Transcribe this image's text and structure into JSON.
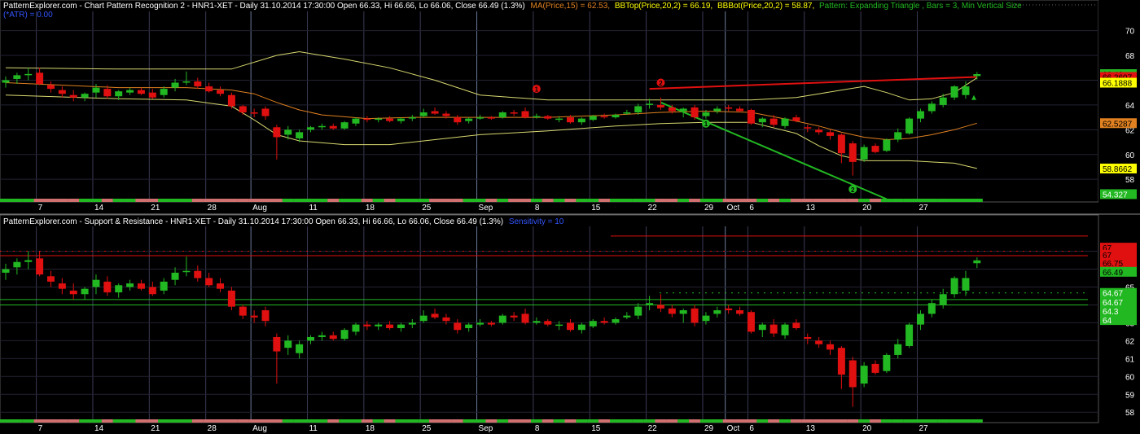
{
  "chart_data": [
    {
      "type": "candlestick",
      "panel": "top",
      "header": {
        "main": "PatternExplorer.com - Chart Pattern Recognition 2 - HNR1-XET - Daily 31.10.2014 17:30:00 Open 66.33, Hi 66.66, Lo 66.06, Close 66.49 (1.3%)",
        "ma": "MA(Price,15) = 62.53,",
        "bbtop": "BBTop(Price,20,2) = 66.19,",
        "bbbot": "BBBot(Price,20,2) = 58.87,",
        "pattern": "Pattern: Expanding Triangle , Bars = 3, Min Vertical Size",
        "atr": "(*ATR) = 0.00"
      },
      "y_ticks": [
        "70",
        "68",
        "66",
        "64",
        "62",
        "60",
        "58"
      ],
      "ylim": [
        56.5,
        70.5
      ],
      "price_tags": [
        {
          "text": "66.49",
          "value": 66.49,
          "bg": "#22b822",
          "fg": "#000000"
        },
        {
          "text": "66.2607",
          "value": 66.26,
          "bg": "#e01010",
          "fg": "#000000"
        },
        {
          "text": "66.1888",
          "value": 65.8,
          "bg": "#ffff00",
          "fg": "#000000"
        },
        {
          "text": "62.5287",
          "value": 62.53,
          "bg": "#e08020",
          "fg": "#000000"
        },
        {
          "text": "58.8662",
          "value": 58.87,
          "bg": "#ffff00",
          "fg": "#000000"
        },
        {
          "text": "54.327",
          "value": 56.8,
          "bg": "#22b822",
          "fg": "#ffffff"
        }
      ],
      "markers": [
        {
          "label": "1",
          "bar": 47,
          "value": 65.3,
          "color": "#e01010"
        },
        {
          "label": "2",
          "bar": 58,
          "value": 65.8,
          "color": "#e01010"
        },
        {
          "label": "1",
          "bar": 62,
          "value": 62.5,
          "color": "#22b822"
        },
        {
          "label": "2",
          "bar": 75,
          "value": 57.2,
          "color": "#22b822"
        }
      ]
    },
    {
      "type": "candlestick",
      "panel": "bottom",
      "header": {
        "main": "PatternExplorer.com - Support & Resistance - HNR1-XET - Daily 31.10.2014 17:30:00 Open 66.33, Hi 66.66, Lo 66.06, Close 66.49 (1.3%)",
        "sens": "Sensitivity = 10"
      },
      "y_ticks": [
        "67",
        "66",
        "65",
        "64",
        "63",
        "62",
        "61",
        "60",
        "59",
        "58"
      ],
      "ylim": [
        57.6,
        68.3
      ],
      "price_tags": [
        {
          "text": "67",
          "value": 67.2,
          "bg": "#e01010",
          "fg": "#000000"
        },
        {
          "text": "67",
          "value": 66.8,
          "bg": "#e01010",
          "fg": "#000000"
        },
        {
          "text": "66.75",
          "value": 66.35,
          "bg": "#e01010",
          "fg": "#000000"
        },
        {
          "text": "66.49",
          "value": 65.85,
          "bg": "#22b822",
          "fg": "#000000"
        },
        {
          "text": "64.67",
          "value": 64.67,
          "bg": "#22b822",
          "fg": "#ffffff"
        },
        {
          "text": "64.67",
          "value": 64.15,
          "bg": "#22b822",
          "fg": "#ffffff"
        },
        {
          "text": "64.3",
          "value": 63.65,
          "bg": "#22b822",
          "fg": "#ffffff"
        },
        {
          "text": "64",
          "value": 63.15,
          "bg": "#22b822",
          "fg": "#ffffff"
        }
      ],
      "levels": [
        {
          "value": 67.85,
          "color": "#e01010"
        },
        {
          "value": 67.0,
          "color": "#e01010"
        },
        {
          "value": 66.75,
          "color": "#e01010"
        },
        {
          "value": 64.67,
          "color": "#22b822"
        },
        {
          "value": 64.3,
          "color": "#22b822"
        },
        {
          "value": 64.0,
          "color": "#22b822"
        }
      ]
    }
  ],
  "x_ticks": [
    {
      "label": "7",
      "bar": 3,
      "month": false
    },
    {
      "label": "14",
      "bar": 8,
      "month": false
    },
    {
      "label": "21",
      "bar": 13,
      "month": false
    },
    {
      "label": "28",
      "bar": 18,
      "month": false
    },
    {
      "label": "Aug",
      "bar": 22,
      "month": true
    },
    {
      "label": "11",
      "bar": 27,
      "month": false
    },
    {
      "label": "18",
      "bar": 32,
      "month": false
    },
    {
      "label": "25",
      "bar": 37,
      "month": false
    },
    {
      "label": "Sep",
      "bar": 42,
      "month": true
    },
    {
      "label": "8",
      "bar": 47,
      "month": false
    },
    {
      "label": "15",
      "bar": 52,
      "month": false
    },
    {
      "label": "22",
      "bar": 57,
      "month": false
    },
    {
      "label": "29",
      "bar": 62,
      "month": false
    },
    {
      "label": "Oct",
      "bar": 64,
      "month": true
    },
    {
      "label": "6",
      "bar": 66,
      "month": false
    },
    {
      "label": "13",
      "bar": 71,
      "month": false
    },
    {
      "label": "20",
      "bar": 76,
      "month": false
    },
    {
      "label": "27",
      "bar": 81,
      "month": false
    }
  ],
  "candles": [
    {
      "o": 65.8,
      "h": 66.3,
      "l": 65.4,
      "c": 66.0
    },
    {
      "o": 66.1,
      "h": 66.6,
      "l": 65.7,
      "c": 66.4
    },
    {
      "o": 66.4,
      "h": 67.0,
      "l": 66.0,
      "c": 66.5
    },
    {
      "o": 66.6,
      "h": 67.0,
      "l": 65.6,
      "c": 65.7
    },
    {
      "o": 65.6,
      "h": 65.9,
      "l": 65.0,
      "c": 65.3
    },
    {
      "o": 65.2,
      "h": 65.5,
      "l": 64.6,
      "c": 64.9
    },
    {
      "o": 64.8,
      "h": 65.2,
      "l": 64.3,
      "c": 64.6
    },
    {
      "o": 64.6,
      "h": 65.0,
      "l": 64.3,
      "c": 64.9
    },
    {
      "o": 65.0,
      "h": 65.7,
      "l": 64.6,
      "c": 65.4
    },
    {
      "o": 65.3,
      "h": 65.6,
      "l": 64.5,
      "c": 64.7
    },
    {
      "o": 64.7,
      "h": 65.2,
      "l": 64.4,
      "c": 65.1
    },
    {
      "o": 65.0,
      "h": 65.4,
      "l": 64.8,
      "c": 65.2
    },
    {
      "o": 65.2,
      "h": 65.4,
      "l": 64.8,
      "c": 64.9
    },
    {
      "o": 65.0,
      "h": 65.3,
      "l": 64.5,
      "c": 64.6
    },
    {
      "o": 64.8,
      "h": 65.5,
      "l": 64.6,
      "c": 65.3
    },
    {
      "o": 65.4,
      "h": 66.1,
      "l": 65.1,
      "c": 65.8
    },
    {
      "o": 65.9,
      "h": 66.7,
      "l": 65.6,
      "c": 65.9
    },
    {
      "o": 65.9,
      "h": 66.2,
      "l": 65.3,
      "c": 65.5
    },
    {
      "o": 65.5,
      "h": 65.8,
      "l": 65.0,
      "c": 65.1
    },
    {
      "o": 65.2,
      "h": 65.5,
      "l": 64.7,
      "c": 64.9
    },
    {
      "o": 64.8,
      "h": 65.0,
      "l": 63.7,
      "c": 63.9
    },
    {
      "o": 63.9,
      "h": 64.0,
      "l": 63.2,
      "c": 63.4
    },
    {
      "o": 63.4,
      "h": 63.7,
      "l": 63.0,
      "c": 63.3
    },
    {
      "o": 63.7,
      "h": 63.9,
      "l": 62.8,
      "c": 63.1
    },
    {
      "o": 62.2,
      "h": 62.4,
      "l": 59.6,
      "c": 61.4
    },
    {
      "o": 61.6,
      "h": 62.3,
      "l": 61.2,
      "c": 62.0
    },
    {
      "o": 61.3,
      "h": 62.0,
      "l": 61.0,
      "c": 61.8
    },
    {
      "o": 62.0,
      "h": 62.3,
      "l": 61.8,
      "c": 62.2
    },
    {
      "o": 62.2,
      "h": 62.5,
      "l": 62.0,
      "c": 62.3
    },
    {
      "o": 62.3,
      "h": 62.5,
      "l": 62.0,
      "c": 62.1
    },
    {
      "o": 62.1,
      "h": 62.7,
      "l": 62.0,
      "c": 62.6
    },
    {
      "o": 62.5,
      "h": 63.0,
      "l": 62.3,
      "c": 62.9
    },
    {
      "o": 62.9,
      "h": 63.1,
      "l": 62.6,
      "c": 62.8
    },
    {
      "o": 62.8,
      "h": 63.0,
      "l": 62.6,
      "c": 62.9
    },
    {
      "o": 62.9,
      "h": 63.1,
      "l": 62.6,
      "c": 62.7
    },
    {
      "o": 62.7,
      "h": 63.0,
      "l": 62.5,
      "c": 62.9
    },
    {
      "o": 62.9,
      "h": 63.2,
      "l": 62.7,
      "c": 63.0
    },
    {
      "o": 63.1,
      "h": 63.7,
      "l": 63.0,
      "c": 63.4
    },
    {
      "o": 63.5,
      "h": 63.8,
      "l": 63.2,
      "c": 63.3
    },
    {
      "o": 63.3,
      "h": 63.5,
      "l": 62.9,
      "c": 63.1
    },
    {
      "o": 63.0,
      "h": 63.2,
      "l": 62.4,
      "c": 62.6
    },
    {
      "o": 62.7,
      "h": 63.0,
      "l": 62.5,
      "c": 62.9
    },
    {
      "o": 62.9,
      "h": 63.2,
      "l": 62.8,
      "c": 63.0
    },
    {
      "o": 63.0,
      "h": 63.1,
      "l": 62.8,
      "c": 62.9
    },
    {
      "o": 63.0,
      "h": 63.5,
      "l": 62.9,
      "c": 63.4
    },
    {
      "o": 63.4,
      "h": 63.6,
      "l": 63.1,
      "c": 63.3
    },
    {
      "o": 63.5,
      "h": 63.8,
      "l": 62.9,
      "c": 63.0
    },
    {
      "o": 63.0,
      "h": 63.3,
      "l": 62.9,
      "c": 63.1
    },
    {
      "o": 63.1,
      "h": 63.2,
      "l": 62.8,
      "c": 62.9
    },
    {
      "o": 62.9,
      "h": 63.1,
      "l": 62.6,
      "c": 62.9
    },
    {
      "o": 63.0,
      "h": 63.2,
      "l": 62.5,
      "c": 62.6
    },
    {
      "o": 62.6,
      "h": 63.0,
      "l": 62.4,
      "c": 62.9
    },
    {
      "o": 62.8,
      "h": 63.2,
      "l": 62.7,
      "c": 63.1
    },
    {
      "o": 63.1,
      "h": 63.3,
      "l": 62.9,
      "c": 63.0
    },
    {
      "o": 63.0,
      "h": 63.3,
      "l": 62.9,
      "c": 63.2
    },
    {
      "o": 63.3,
      "h": 63.6,
      "l": 63.2,
      "c": 63.4
    },
    {
      "o": 63.4,
      "h": 64.1,
      "l": 63.2,
      "c": 63.9
    },
    {
      "o": 64.0,
      "h": 64.5,
      "l": 63.7,
      "c": 64.1
    },
    {
      "o": 64.0,
      "h": 64.6,
      "l": 63.6,
      "c": 63.8
    },
    {
      "o": 63.8,
      "h": 64.0,
      "l": 63.3,
      "c": 63.5
    },
    {
      "o": 63.5,
      "h": 63.8,
      "l": 63.0,
      "c": 63.7
    },
    {
      "o": 63.8,
      "h": 64.0,
      "l": 62.8,
      "c": 63.0
    },
    {
      "o": 63.1,
      "h": 63.6,
      "l": 62.9,
      "c": 63.4
    },
    {
      "o": 63.5,
      "h": 63.9,
      "l": 63.3,
      "c": 63.7
    },
    {
      "o": 63.8,
      "h": 64.0,
      "l": 63.5,
      "c": 63.7
    },
    {
      "o": 63.7,
      "h": 63.9,
      "l": 63.4,
      "c": 63.5
    },
    {
      "o": 63.6,
      "h": 63.7,
      "l": 62.4,
      "c": 62.5
    },
    {
      "o": 62.6,
      "h": 63.0,
      "l": 62.2,
      "c": 62.9
    },
    {
      "o": 62.9,
      "h": 63.2,
      "l": 62.2,
      "c": 62.4
    },
    {
      "o": 62.3,
      "h": 63.0,
      "l": 62.1,
      "c": 62.9
    },
    {
      "o": 63.0,
      "h": 63.2,
      "l": 62.6,
      "c": 62.7
    },
    {
      "o": 62.2,
      "h": 62.4,
      "l": 61.8,
      "c": 62.1
    },
    {
      "o": 62.0,
      "h": 62.2,
      "l": 61.6,
      "c": 61.8
    },
    {
      "o": 61.8,
      "h": 62.0,
      "l": 61.2,
      "c": 61.5
    },
    {
      "o": 61.6,
      "h": 61.7,
      "l": 59.3,
      "c": 60.1
    },
    {
      "o": 60.9,
      "h": 61.1,
      "l": 58.3,
      "c": 59.4
    },
    {
      "o": 59.6,
      "h": 60.8,
      "l": 59.4,
      "c": 60.6
    },
    {
      "o": 60.7,
      "h": 60.9,
      "l": 60.1,
      "c": 60.2
    },
    {
      "o": 60.3,
      "h": 61.3,
      "l": 60.2,
      "c": 61.2
    },
    {
      "o": 61.2,
      "h": 62.1,
      "l": 61.0,
      "c": 61.8
    },
    {
      "o": 61.7,
      "h": 63.0,
      "l": 61.6,
      "c": 62.9
    },
    {
      "o": 62.9,
      "h": 63.7,
      "l": 62.6,
      "c": 63.5
    },
    {
      "o": 63.5,
      "h": 64.3,
      "l": 63.3,
      "c": 64.1
    },
    {
      "o": 64.0,
      "h": 64.9,
      "l": 63.8,
      "c": 64.6
    },
    {
      "o": 64.6,
      "h": 65.6,
      "l": 64.4,
      "c": 65.5
    },
    {
      "o": 64.8,
      "h": 65.9,
      "l": 64.5,
      "c": 65.5
    },
    {
      "o": 66.33,
      "h": 66.66,
      "l": 66.06,
      "c": 66.49
    }
  ],
  "indicators": {
    "bb_top": [
      [
        0,
        67.0
      ],
      [
        10,
        66.9
      ],
      [
        16,
        66.9
      ],
      [
        20,
        66.9
      ],
      [
        24,
        68.0
      ],
      [
        26,
        68.3
      ],
      [
        30,
        67.7
      ],
      [
        34,
        67.0
      ],
      [
        38,
        66.0
      ],
      [
        42,
        64.8
      ],
      [
        48,
        64.4
      ],
      [
        54,
        64.4
      ],
      [
        58,
        64.4
      ],
      [
        62,
        64.4
      ],
      [
        66,
        64.4
      ],
      [
        70,
        64.6
      ],
      [
        72,
        64.9
      ],
      [
        74,
        65.2
      ],
      [
        76,
        65.5
      ],
      [
        78,
        65.0
      ],
      [
        80,
        64.4
      ],
      [
        82,
        64.5
      ],
      [
        84,
        65.0
      ],
      [
        86,
        66.19
      ]
    ],
    "ma": [
      [
        0,
        65.8
      ],
      [
        10,
        65.4
      ],
      [
        16,
        65.4
      ],
      [
        20,
        65.2
      ],
      [
        22,
        64.9
      ],
      [
        24,
        64.2
      ],
      [
        26,
        63.6
      ],
      [
        28,
        63.2
      ],
      [
        32,
        62.9
      ],
      [
        36,
        63.0
      ],
      [
        42,
        63.0
      ],
      [
        48,
        63.0
      ],
      [
        54,
        63.2
      ],
      [
        58,
        63.4
      ],
      [
        62,
        63.5
      ],
      [
        66,
        63.4
      ],
      [
        70,
        62.7
      ],
      [
        72,
        62.3
      ],
      [
        74,
        61.8
      ],
      [
        76,
        61.4
      ],
      [
        78,
        61.2
      ],
      [
        80,
        61.3
      ],
      [
        82,
        61.6
      ],
      [
        84,
        62.0
      ],
      [
        86,
        62.53
      ]
    ],
    "bb_bot": [
      [
        0,
        64.8
      ],
      [
        10,
        64.5
      ],
      [
        16,
        64.4
      ],
      [
        20,
        63.9
      ],
      [
        22,
        62.8
      ],
      [
        24,
        61.6
      ],
      [
        26,
        61.1
      ],
      [
        30,
        60.8
      ],
      [
        34,
        60.8
      ],
      [
        38,
        61.2
      ],
      [
        42,
        61.6
      ],
      [
        48,
        61.9
      ],
      [
        54,
        62.3
      ],
      [
        58,
        62.5
      ],
      [
        62,
        62.6
      ],
      [
        66,
        62.6
      ],
      [
        70,
        61.7
      ],
      [
        72,
        60.7
      ],
      [
        74,
        59.9
      ],
      [
        76,
        59.5
      ],
      [
        80,
        59.5
      ],
      [
        84,
        59.3
      ],
      [
        86,
        58.87
      ]
    ],
    "trend_red": [
      [
        57,
        65.3
      ],
      [
        86,
        66.26
      ]
    ],
    "trend_green": [
      [
        58,
        64.2
      ],
      [
        78,
        56.4
      ]
    ]
  },
  "colors": {
    "up": "#22b822",
    "down": "#e01010",
    "ma": "#e08020",
    "bb": "#d8d870",
    "grid": "#3a3a55",
    "header_main": "#ffffff",
    "header_ma": "#e08020",
    "header_bb": "#ffff00",
    "header_pattern": "#22b822",
    "header_atr": "#3355ff"
  }
}
